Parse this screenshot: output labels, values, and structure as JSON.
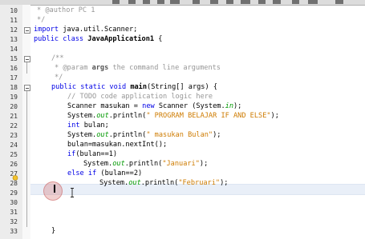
{
  "editor": {
    "line_numbers": [
      "10",
      "11",
      "12",
      "13",
      "14",
      "15",
      "16",
      "17",
      "18",
      "19",
      "20",
      "21",
      "22",
      "23",
      "24",
      "25",
      "26",
      "27",
      "28",
      "29",
      "30",
      "31",
      "32",
      "33"
    ],
    "lines": {
      "l10": "* @author PC 1",
      "l11": "*/",
      "l12_kw": "import",
      "l12_rest": " java.util.Scanner;",
      "l13_kw": "public class",
      "l13_name": "JavaApplication1",
      "l13_rest": " {",
      "l15": "/**",
      "l16_a": "* @param ",
      "l16_b": "args",
      "l16_c": " the command line arguments",
      "l17": "*/",
      "l18_kw": "public static void",
      "l18_name": "main",
      "l18_rest": "(String[] args) {",
      "l19": "// TODO code application logic here",
      "l20_a": "Scanner masukan = ",
      "l20_kw": "new",
      "l20_b": " Scanner (System.",
      "l20_fld": "in",
      "l20_c": ");",
      "l21_a": "System.",
      "l21_fld": "out",
      "l21_b": ".println(",
      "l21_str": "\" PROGRAM BELAJAR IF AND ELSE\"",
      "l21_c": ");",
      "l22_kw": "int",
      "l22_rest": " bulan;",
      "l23_a": "System.",
      "l23_fld": "out",
      "l23_b": ".println(",
      "l23_str": "\" masukan Bulan\"",
      "l23_c": ");",
      "l24": "bulan=masukan.nextInt();",
      "l25_kw": "if",
      "l25_rest": "(bulan==1)",
      "l26_a": "System.",
      "l26_fld": "out",
      "l26_b": ".println(",
      "l26_str": "\"Januari\"",
      "l26_c": ");",
      "l27_kw1": "else",
      "l27_kw2": "if",
      "l27_rest": " (bulan==2)",
      "l28_a": "System.",
      "l28_fld": "out",
      "l28_b": ".println(",
      "l28_str": "\"Februari\"",
      "l28_c": ");",
      "l33": "}"
    }
  },
  "colors": {
    "keyword": "#0000e6",
    "string": "#ce7b00",
    "comment": "#969696",
    "field": "#009900",
    "current_line": "#e9eff8"
  },
  "icons": [
    "toolbar-icon",
    "fold-toggle-icon",
    "hint-lightbulb-icon",
    "text-caret",
    "mouse-ibeam-cursor"
  ]
}
